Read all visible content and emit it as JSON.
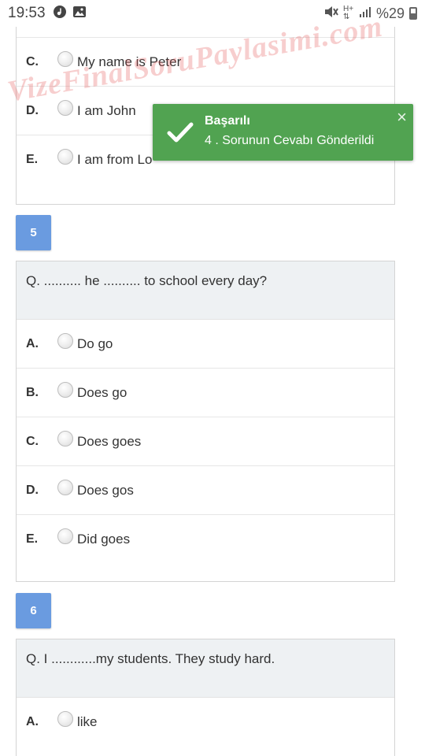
{
  "status_bar": {
    "time": "19:53",
    "battery": "%29"
  },
  "watermark": "VizeFinalSoruPaylasimi.com",
  "toast": {
    "title": "Başarılı",
    "message": "4 . Sorunun Cevabı Gönderildi",
    "close": "×"
  },
  "q4": {
    "options": [
      {
        "letter": "C.",
        "text": "My name is Peter"
      },
      {
        "letter": "D.",
        "text": "I am John"
      },
      {
        "letter": "E.",
        "text": "I am from Lo"
      }
    ]
  },
  "q5": {
    "number": "5",
    "question": "Q. .......... he .......... to school every day?",
    "options": [
      {
        "letter": "A.",
        "text": "Do go"
      },
      {
        "letter": "B.",
        "text": "Does go"
      },
      {
        "letter": "C.",
        "text": "Does goes"
      },
      {
        "letter": "D.",
        "text": "Does gos"
      },
      {
        "letter": "E.",
        "text": "Did goes"
      }
    ]
  },
  "q6": {
    "number": "6",
    "question": "Q. I ............my students. They study hard.",
    "options": [
      {
        "letter": "A.",
        "text": "like"
      }
    ]
  }
}
